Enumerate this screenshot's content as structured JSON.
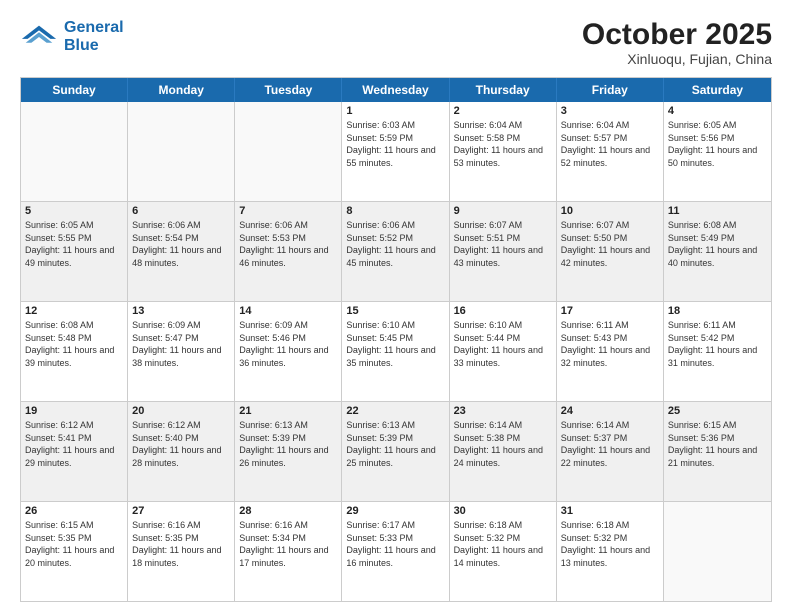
{
  "header": {
    "logo_line1": "General",
    "logo_line2": "Blue",
    "month": "October 2025",
    "location": "Xinluoqu, Fujian, China"
  },
  "day_headers": [
    "Sunday",
    "Monday",
    "Tuesday",
    "Wednesday",
    "Thursday",
    "Friday",
    "Saturday"
  ],
  "weeks": [
    [
      {
        "day": "",
        "info": "",
        "empty": true
      },
      {
        "day": "",
        "info": "",
        "empty": true
      },
      {
        "day": "",
        "info": "",
        "empty": true
      },
      {
        "day": "1",
        "info": "Sunrise: 6:03 AM\nSunset: 5:59 PM\nDaylight: 11 hours\nand 55 minutes."
      },
      {
        "day": "2",
        "info": "Sunrise: 6:04 AM\nSunset: 5:58 PM\nDaylight: 11 hours\nand 53 minutes."
      },
      {
        "day": "3",
        "info": "Sunrise: 6:04 AM\nSunset: 5:57 PM\nDaylight: 11 hours\nand 52 minutes."
      },
      {
        "day": "4",
        "info": "Sunrise: 6:05 AM\nSunset: 5:56 PM\nDaylight: 11 hours\nand 50 minutes."
      }
    ],
    [
      {
        "day": "5",
        "info": "Sunrise: 6:05 AM\nSunset: 5:55 PM\nDaylight: 11 hours\nand 49 minutes.",
        "shaded": true
      },
      {
        "day": "6",
        "info": "Sunrise: 6:06 AM\nSunset: 5:54 PM\nDaylight: 11 hours\nand 48 minutes.",
        "shaded": true
      },
      {
        "day": "7",
        "info": "Sunrise: 6:06 AM\nSunset: 5:53 PM\nDaylight: 11 hours\nand 46 minutes.",
        "shaded": true
      },
      {
        "day": "8",
        "info": "Sunrise: 6:06 AM\nSunset: 5:52 PM\nDaylight: 11 hours\nand 45 minutes.",
        "shaded": true
      },
      {
        "day": "9",
        "info": "Sunrise: 6:07 AM\nSunset: 5:51 PM\nDaylight: 11 hours\nand 43 minutes.",
        "shaded": true
      },
      {
        "day": "10",
        "info": "Sunrise: 6:07 AM\nSunset: 5:50 PM\nDaylight: 11 hours\nand 42 minutes.",
        "shaded": true
      },
      {
        "day": "11",
        "info": "Sunrise: 6:08 AM\nSunset: 5:49 PM\nDaylight: 11 hours\nand 40 minutes.",
        "shaded": true
      }
    ],
    [
      {
        "day": "12",
        "info": "Sunrise: 6:08 AM\nSunset: 5:48 PM\nDaylight: 11 hours\nand 39 minutes."
      },
      {
        "day": "13",
        "info": "Sunrise: 6:09 AM\nSunset: 5:47 PM\nDaylight: 11 hours\nand 38 minutes."
      },
      {
        "day": "14",
        "info": "Sunrise: 6:09 AM\nSunset: 5:46 PM\nDaylight: 11 hours\nand 36 minutes."
      },
      {
        "day": "15",
        "info": "Sunrise: 6:10 AM\nSunset: 5:45 PM\nDaylight: 11 hours\nand 35 minutes."
      },
      {
        "day": "16",
        "info": "Sunrise: 6:10 AM\nSunset: 5:44 PM\nDaylight: 11 hours\nand 33 minutes."
      },
      {
        "day": "17",
        "info": "Sunrise: 6:11 AM\nSunset: 5:43 PM\nDaylight: 11 hours\nand 32 minutes."
      },
      {
        "day": "18",
        "info": "Sunrise: 6:11 AM\nSunset: 5:42 PM\nDaylight: 11 hours\nand 31 minutes."
      }
    ],
    [
      {
        "day": "19",
        "info": "Sunrise: 6:12 AM\nSunset: 5:41 PM\nDaylight: 11 hours\nand 29 minutes.",
        "shaded": true
      },
      {
        "day": "20",
        "info": "Sunrise: 6:12 AM\nSunset: 5:40 PM\nDaylight: 11 hours\nand 28 minutes.",
        "shaded": true
      },
      {
        "day": "21",
        "info": "Sunrise: 6:13 AM\nSunset: 5:39 PM\nDaylight: 11 hours\nand 26 minutes.",
        "shaded": true
      },
      {
        "day": "22",
        "info": "Sunrise: 6:13 AM\nSunset: 5:39 PM\nDaylight: 11 hours\nand 25 minutes.",
        "shaded": true
      },
      {
        "day": "23",
        "info": "Sunrise: 6:14 AM\nSunset: 5:38 PM\nDaylight: 11 hours\nand 24 minutes.",
        "shaded": true
      },
      {
        "day": "24",
        "info": "Sunrise: 6:14 AM\nSunset: 5:37 PM\nDaylight: 11 hours\nand 22 minutes.",
        "shaded": true
      },
      {
        "day": "25",
        "info": "Sunrise: 6:15 AM\nSunset: 5:36 PM\nDaylight: 11 hours\nand 21 minutes.",
        "shaded": true
      }
    ],
    [
      {
        "day": "26",
        "info": "Sunrise: 6:15 AM\nSunset: 5:35 PM\nDaylight: 11 hours\nand 20 minutes."
      },
      {
        "day": "27",
        "info": "Sunrise: 6:16 AM\nSunset: 5:35 PM\nDaylight: 11 hours\nand 18 minutes."
      },
      {
        "day": "28",
        "info": "Sunrise: 6:16 AM\nSunset: 5:34 PM\nDaylight: 11 hours\nand 17 minutes."
      },
      {
        "day": "29",
        "info": "Sunrise: 6:17 AM\nSunset: 5:33 PM\nDaylight: 11 hours\nand 16 minutes."
      },
      {
        "day": "30",
        "info": "Sunrise: 6:18 AM\nSunset: 5:32 PM\nDaylight: 11 hours\nand 14 minutes."
      },
      {
        "day": "31",
        "info": "Sunrise: 6:18 AM\nSunset: 5:32 PM\nDaylight: 11 hours\nand 13 minutes."
      },
      {
        "day": "",
        "info": "",
        "empty": true
      }
    ]
  ]
}
